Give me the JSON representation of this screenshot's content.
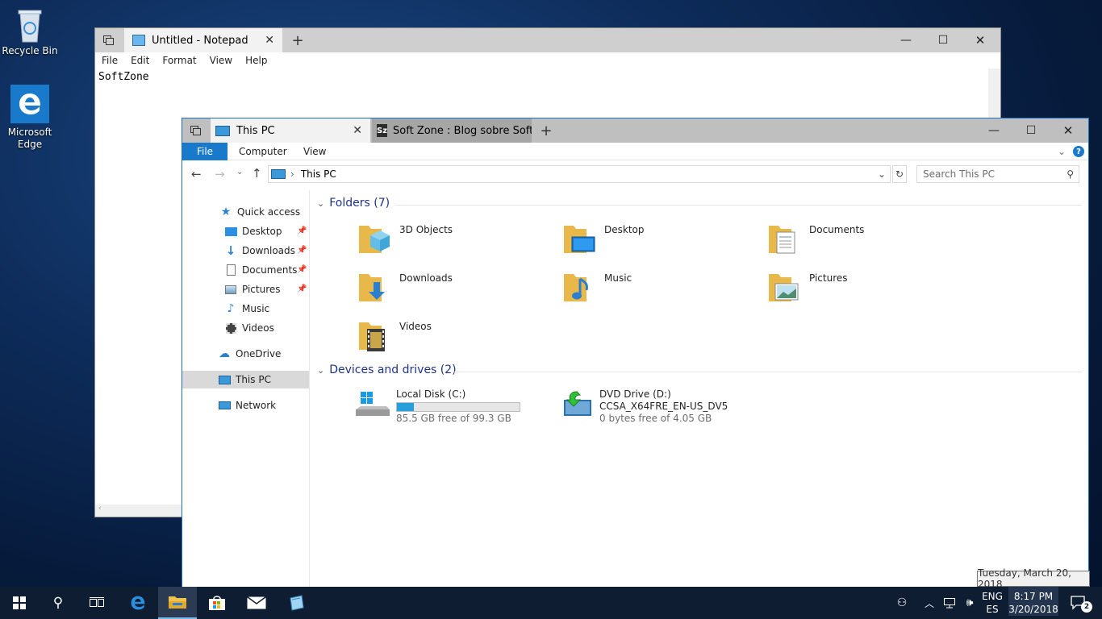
{
  "desktop": {
    "icons": [
      {
        "label": "Recycle Bin"
      },
      {
        "label": "Microsoft Edge"
      }
    ]
  },
  "notepad": {
    "tab_title": "Untitled - Notepad",
    "menu": [
      "File",
      "Edit",
      "Format",
      "View",
      "Help"
    ],
    "content": "SoftZone"
  },
  "explorer": {
    "tabs": [
      {
        "label": "This PC"
      },
      {
        "label": "Soft Zone : Blog sobre Softw"
      }
    ],
    "ribbon_tabs": [
      "File",
      "Computer",
      "View"
    ],
    "address": "This PC",
    "search_placeholder": "Search This PC",
    "nav": [
      {
        "label": "Quick access"
      },
      {
        "label": "Desktop"
      },
      {
        "label": "Downloads"
      },
      {
        "label": "Documents"
      },
      {
        "label": "Pictures"
      },
      {
        "label": "Music"
      },
      {
        "label": "Videos"
      },
      {
        "label": "OneDrive"
      },
      {
        "label": "This PC"
      },
      {
        "label": "Network"
      }
    ],
    "folders_header": "Folders (7)",
    "folders": [
      {
        "name": "3D Objects"
      },
      {
        "name": "Desktop"
      },
      {
        "name": "Documents"
      },
      {
        "name": "Downloads"
      },
      {
        "name": "Music"
      },
      {
        "name": "Pictures"
      },
      {
        "name": "Videos"
      }
    ],
    "devices_header": "Devices and drives (2)",
    "drives": [
      {
        "name": "Local Disk (C:)",
        "free": "85.5 GB free of 99.3 GB",
        "used_fraction": 0.14
      },
      {
        "name": "DVD Drive (D:)",
        "label": "CCSA_X64FRE_EN-US_DV5",
        "free": "0 bytes free of 4.05 GB"
      }
    ]
  },
  "taskbar": {
    "lang_top": "ENG",
    "lang_bottom": "ES",
    "time": "8:17 PM",
    "date": "3/20/2018",
    "notifications": "2"
  },
  "tooltip": "Tuesday, March 20, 2018",
  "colors": {
    "accent": "#1e6fbf",
    "file_tab": "#1979ca",
    "selection": "#d9d9d9"
  }
}
